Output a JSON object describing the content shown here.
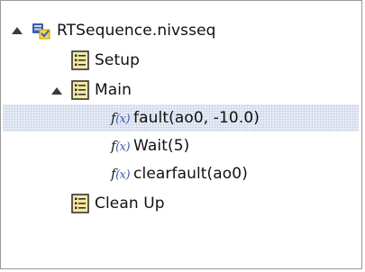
{
  "tree": {
    "root": {
      "label": "RTSequence.nivsseq",
      "icon": "sequence-file-icon",
      "expanded": true
    },
    "setup": {
      "label": "Setup",
      "icon": "step-list-icon"
    },
    "main": {
      "label": "Main",
      "icon": "step-list-icon",
      "expanded": true,
      "steps": [
        {
          "label": "fault(ao0, -10.0)",
          "icon": "function-icon",
          "selected": true
        },
        {
          "label": "Wait(5)",
          "icon": "function-icon",
          "selected": false
        },
        {
          "label": "clearfault(ao0)",
          "icon": "function-icon",
          "selected": false
        }
      ]
    },
    "cleanup": {
      "label": "Clean Up",
      "icon": "step-list-icon"
    }
  },
  "fx_glyph": {
    "f": "f",
    "x": "(x)"
  },
  "colors": {
    "selection": "#e8ecf5",
    "icon_blue": "#3a5fb0",
    "icon_gold": "#e0a800",
    "list_icon_yellow": "#f4e9a0",
    "border": "#9a9a9a"
  }
}
